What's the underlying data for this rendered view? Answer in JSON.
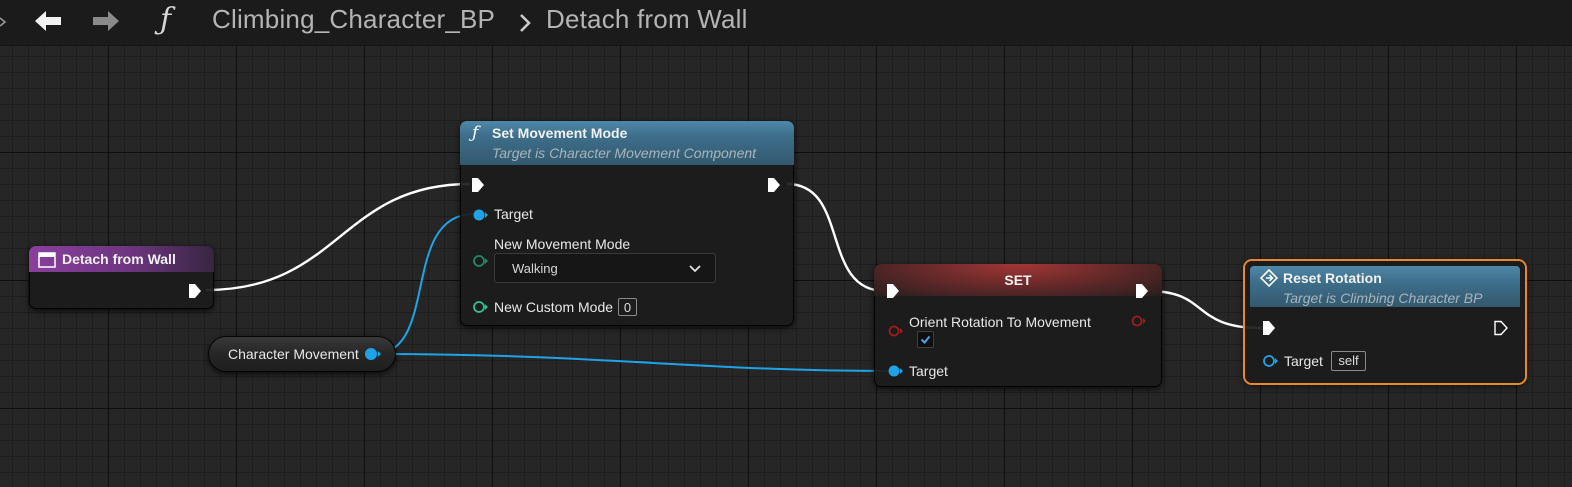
{
  "topbar": {
    "title": "Climbing_Character_BP",
    "subtitle": "Detach from Wall",
    "back_icon": "arrow-left-icon",
    "forward_icon": "arrow-right-icon",
    "function_icon": "function-icon"
  },
  "nodes": {
    "event": {
      "title": "Detach from Wall",
      "header_color": "#7d3c8f"
    },
    "set_movement_mode": {
      "title": "Set Movement Mode",
      "subtitle": "Target is Character Movement Component",
      "target_label": "Target",
      "mode_label": "New Movement Mode",
      "mode_value": "Walking",
      "custom_label": "New Custom Mode",
      "custom_value": "0",
      "header_color": "#3b6f8f"
    },
    "character_movement": {
      "label": "Character Movement"
    },
    "set": {
      "title": "SET",
      "orient_label": "Orient Rotation To Movement",
      "orient_checked": true,
      "target_label": "Target",
      "header_color": "#8a2e2e"
    },
    "reset_rotation": {
      "title": "Reset Rotation",
      "subtitle": "Target is Climbing Character BP",
      "target_label": "Target",
      "target_value": "self",
      "header_color": "#3b6f8f",
      "highlight_color": "#e8892a"
    }
  },
  "colors": {
    "exec_wire": "#ffffff",
    "object_pin": "#1fa3e6",
    "bool_pin": "#9b1c1c",
    "int_pin": "#2ec28f"
  }
}
